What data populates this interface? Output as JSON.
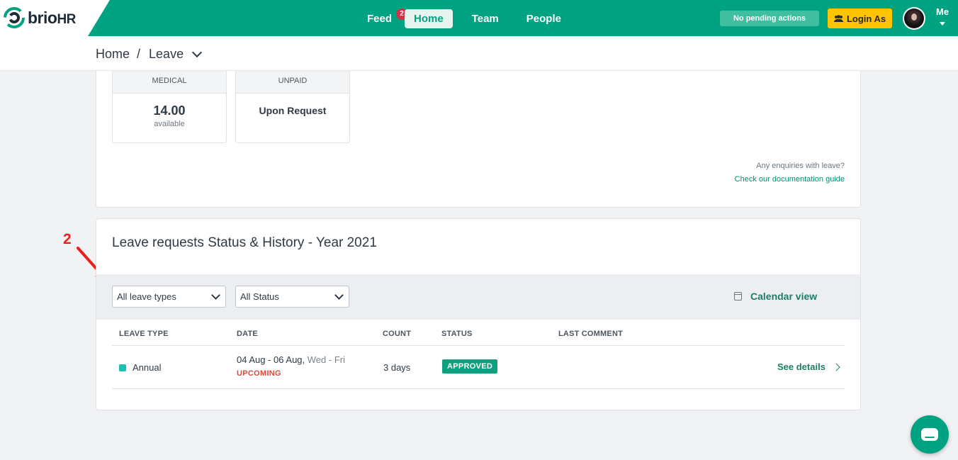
{
  "app": {
    "logo_main": "brio",
    "logo_suffix": "HR"
  },
  "nav": {
    "items": [
      {
        "label": "Feed",
        "badge": "2"
      },
      {
        "label": "Home",
        "active": true
      },
      {
        "label": "Team"
      },
      {
        "label": "People"
      }
    ],
    "pending": "No pending actions",
    "login_as": "Login As",
    "user": "Me"
  },
  "breadcrumb": {
    "home": "Home",
    "separator": "/",
    "current": "Leave"
  },
  "balances": [
    {
      "type": "MEDICAL",
      "value": "14.00",
      "unit": "available"
    },
    {
      "type": "UNPAID",
      "value": "Upon Request"
    }
  ],
  "help": {
    "question": "Any enquiries with leave?",
    "link": "Check our documentation guide"
  },
  "requests": {
    "title": "Leave requests Status & History - Year 2021",
    "filters": {
      "leave_type": "All leave types",
      "status": "All Status"
    },
    "calendar_view": "Calendar view",
    "columns": [
      "LEAVE TYPE",
      "DATE",
      "COUNT",
      "STATUS",
      "LAST COMMENT"
    ],
    "rows": [
      {
        "leave_type": "Annual",
        "date_range": "04 Aug - 06 Aug,",
        "days": "Wed - Fri",
        "tag": "UPCOMING",
        "count": "3 days",
        "status": "APPROVED",
        "last_comment": "",
        "action": "See details"
      }
    ]
  },
  "annotation": {
    "number": "2"
  },
  "colors": {
    "brand": "#00a381",
    "warning": "#ffc300",
    "status_approved": "#0fa07f",
    "upcoming": "#e0493c"
  }
}
